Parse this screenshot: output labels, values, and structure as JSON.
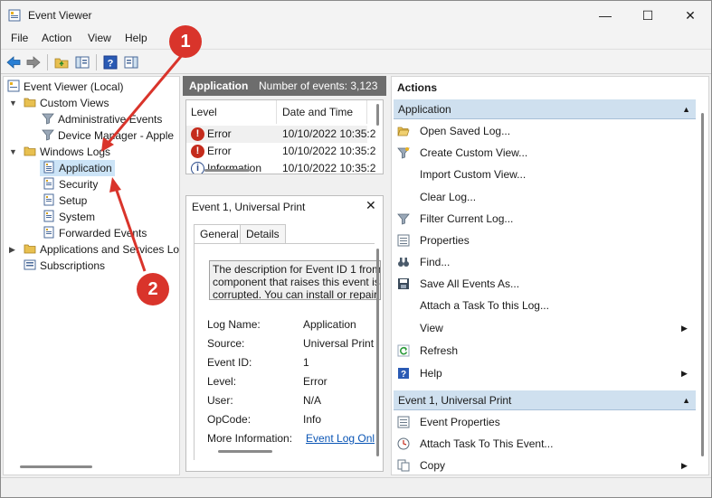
{
  "window": {
    "title": "Event Viewer",
    "minimize": "—",
    "maximize": "☐",
    "close": "✕"
  },
  "menu": [
    "File",
    "Action",
    "View",
    "Help"
  ],
  "tree": {
    "root": "Event Viewer (Local)",
    "custom_views": "Custom Views",
    "admin_events": "Administrative Events",
    "device_manager": "Device Manager - Apple",
    "windows_logs": "Windows Logs",
    "application": "Application",
    "security": "Security",
    "setup": "Setup",
    "system": "System",
    "forwarded": "Forwarded Events",
    "apps_services": "Applications and Services Lo",
    "subscriptions": "Subscriptions"
  },
  "list": {
    "header_title": "Application",
    "header_count": "Number of events: 3,123",
    "col_level": "Level",
    "col_date": "Date and Time",
    "rows": [
      {
        "level": "Error",
        "date": "10/10/2022 10:35:2"
      },
      {
        "level": "Error",
        "date": "10/10/2022 10:35:2"
      },
      {
        "level": "Information",
        "date": "10/10/2022 10:35:2"
      }
    ]
  },
  "detail": {
    "title": "Event 1, Universal Print",
    "tab_general": "General",
    "tab_details": "Details",
    "desc_line1": "The description for Event ID 1 from",
    "desc_line2": "component that raises this event is",
    "desc_line3": "corrupted. You can install or repair",
    "fields": [
      {
        "k": "Log Name:",
        "v": "Application"
      },
      {
        "k": "Source:",
        "v": "Universal Print"
      },
      {
        "k": "Event ID:",
        "v": "1"
      },
      {
        "k": "Level:",
        "v": "Error"
      },
      {
        "k": "User:",
        "v": "N/A"
      },
      {
        "k": "OpCode:",
        "v": "Info"
      }
    ],
    "more_info_label": "More Information:",
    "more_info_link": "Event Log Onl"
  },
  "actions": {
    "title": "Actions",
    "section1": "Application",
    "items1": [
      "Open Saved Log...",
      "Create Custom View...",
      "Import Custom View...",
      "Clear Log...",
      "Filter Current Log...",
      "Properties",
      "Find...",
      "Save All Events As...",
      "Attach a Task To this Log...",
      "View",
      "Refresh",
      "Help"
    ],
    "section2": "Event 1, Universal Print",
    "items2": [
      "Event Properties",
      "Attach Task To This Event...",
      "Copy"
    ]
  },
  "annotations": {
    "badge1": "1",
    "badge2": "2",
    "color": "#d9342b"
  }
}
